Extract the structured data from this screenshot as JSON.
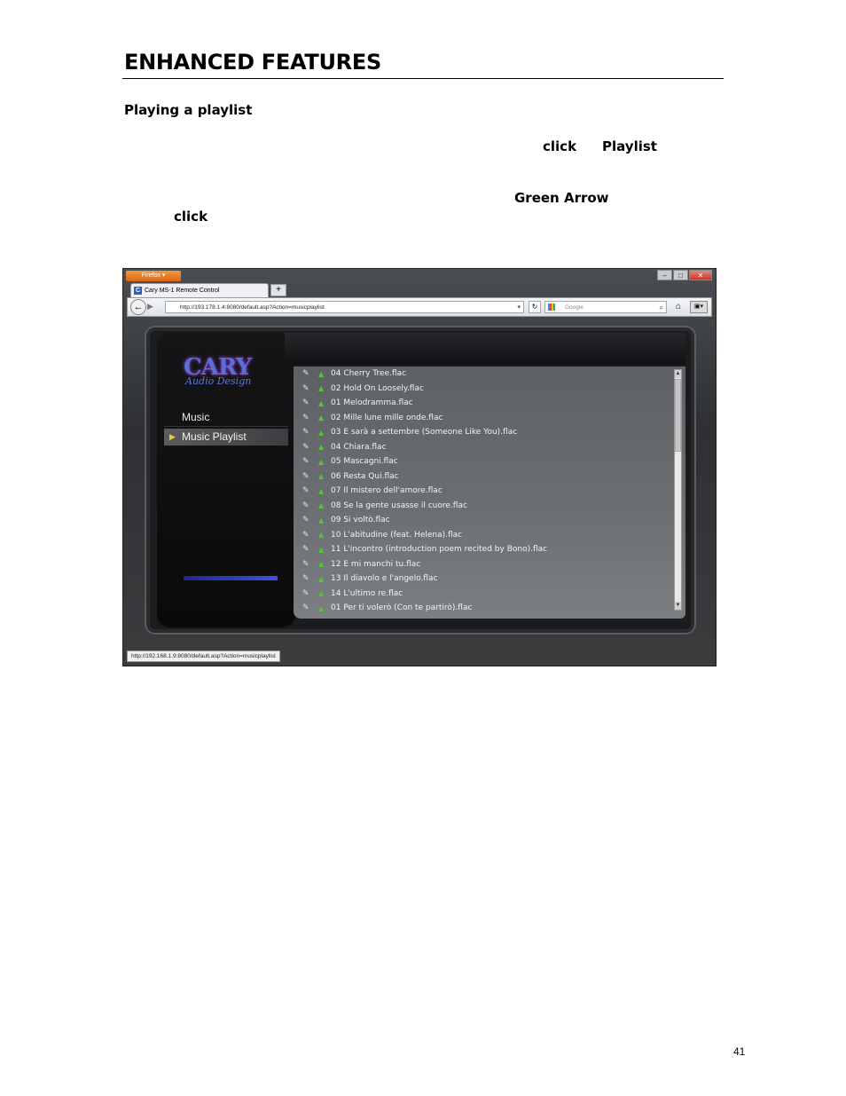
{
  "heading": "ENHANCED FEATURES",
  "subheading": "Playing a playlist",
  "inline_keywords": {
    "click_1": "click",
    "playlist": "Playlist",
    "green_arrow": "Green Arrow",
    "click_2": "click"
  },
  "browser": {
    "menu_button": "Firefox",
    "tab_title": "Cary MS-1 Remote Control",
    "new_tab": "+",
    "url": "http://193.178.1.4:8080/default.asp?Action=musicplaylist",
    "search_placeholder": "Google",
    "status_url": "http://192.168.1.9:8080/default.asp?Action=musicplaylist"
  },
  "app": {
    "logo_line1": "CARY",
    "logo_line2": "Audio Design",
    "nav": [
      "Music",
      "Music Playlist"
    ],
    "tracks": [
      "04 Cherry Tree.flac",
      "02 Hold On Loosely.flac",
      "01 Melodramma.flac",
      "02 Mille lune mille onde.flac",
      "03 E sarà a settembre (Someone Like You).flac",
      "04 Chiara.flac",
      "05 Mascagni.flac",
      "06 Resta Qui.flac",
      "07 Il mistero dell'amore.flac",
      "08 Se la gente usasse il cuore.flac",
      "09 Si voltò.flac",
      "10 L'abitudine (feat. Helena).flac",
      "11 L'incontro (introduction poem recited by Bono).flac",
      "12 E mi manchi tu.flac",
      "13 Il diavolo e l'angelo.flac",
      "14 L'ultimo re.flac",
      "01 Per ti volerò (Con te partirò).flac"
    ]
  },
  "icons": {
    "edit": "edit-icon",
    "play": "green-arrow-icon"
  },
  "colors": {
    "play_arrow": "#57c23c",
    "accent": "#e8d23a"
  },
  "page_number": "41"
}
